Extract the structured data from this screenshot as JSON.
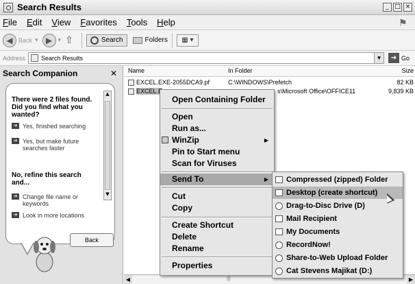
{
  "window": {
    "title": "Search Results",
    "controls": [
      "_",
      "□",
      "×"
    ]
  },
  "menubar": {
    "items": [
      "File",
      "Edit",
      "View",
      "Favorites",
      "Tools",
      "Help"
    ]
  },
  "toolbar": {
    "back": "Back",
    "search": "Search",
    "folders": "Folders",
    "views": "▦ ▾"
  },
  "address": {
    "label": "Address",
    "value": "Search Results",
    "go": "Go"
  },
  "companion": {
    "title": "Search Companion",
    "question": "There were 2 files found. Did you find what you wanted?",
    "options": [
      "Yes, finished searching",
      "Yes, but make future searches faster"
    ],
    "refine": "No, refine this search and...",
    "refine_options": [
      "Change file name or keywords",
      "Look in more locations"
    ],
    "back": "Back"
  },
  "list": {
    "columns": {
      "name": "Name",
      "folder": "In Folder",
      "size": "Size"
    },
    "rows": [
      {
        "name": "EXCEL.EXE-2055DCA9.pf",
        "folder": "C:\\WINDOWS\\Prefetch",
        "size": "82 KB"
      },
      {
        "name": "EXCEL.E",
        "folder": "s\\Microsoft Office\\OFFICE11",
        "size": "9,839 KB"
      }
    ]
  },
  "context_menu": {
    "open_containing": "Open Containing Folder",
    "open": "Open",
    "run_as": "Run as...",
    "winzip": "WinZip",
    "pin": "Pin to Start menu",
    "scan": "Scan for Viruses",
    "send_to": "Send To",
    "cut": "Cut",
    "copy": "Copy",
    "create_shortcut": "Create Shortcut",
    "delete": "Delete",
    "rename": "Rename",
    "properties": "Properties"
  },
  "send_to_menu": {
    "items": [
      "Compressed (zipped) Folder",
      "Desktop (create shortcut)",
      "Drag-to-Disc Drive (D)",
      "Mail Recipient",
      "My Documents",
      "RecordNow!",
      "Share-to-Web Upload Folder",
      "Cat Stevens Majikat (D:)"
    ],
    "highlighted": "Desktop (create shortcut)"
  }
}
